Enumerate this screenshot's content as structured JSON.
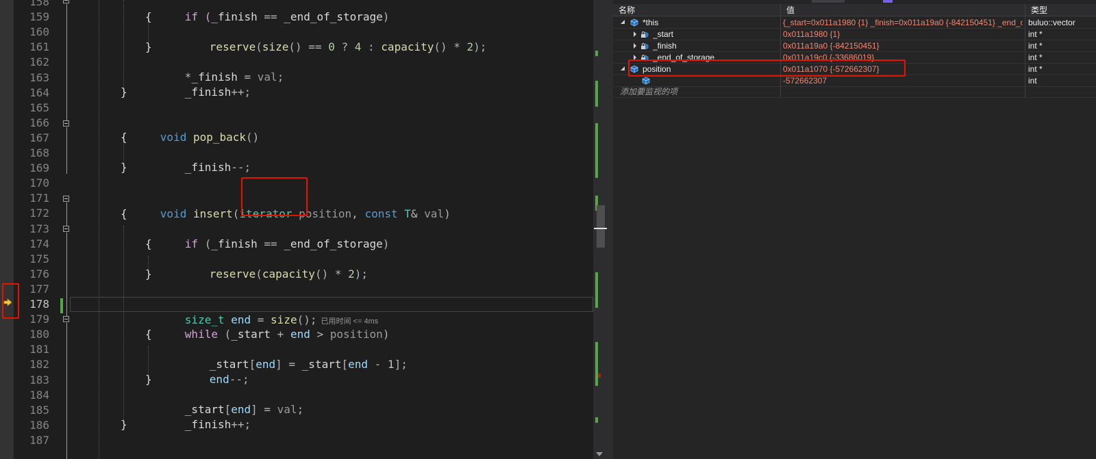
{
  "editor": {
    "line_numbers": [
      "158",
      "159",
      "160",
      "161",
      "162",
      "163",
      "164",
      "165",
      "166",
      "167",
      "168",
      "169",
      "170",
      "171",
      "172",
      "173",
      "174",
      "175",
      "176",
      "177",
      "178",
      "179",
      "180",
      "181",
      "182",
      "183",
      "184",
      "185",
      "186",
      "187"
    ],
    "current_line": "178",
    "code": {
      "l158": {
        "a": "if (",
        "b": "_finish",
        "c": " == ",
        "d": "_end_of_storage",
        "e": ")"
      },
      "l159": "{",
      "l160": {
        "fn": "reserve",
        "p1": "(",
        "fn2": "size",
        "p2": "() == ",
        "n1": "0",
        "p3": " ? ",
        "n2": "4",
        "p4": " : ",
        "fn3": "capacity",
        "p5": "() * ",
        "n3": "2",
        "p6": ");"
      },
      "l161": "}",
      "l162": {
        "a": "*",
        "b": "_finish",
        "c": " = ",
        "d": "val",
        "e": ";"
      },
      "l163": {
        "a": "_finish",
        "b": "++;"
      },
      "l164": "}",
      "l166": {
        "kw": "void",
        "fn": "pop_back",
        "p": "()"
      },
      "l167": "{",
      "l168": {
        "a": "_finish",
        "b": "--;"
      },
      "l169": "}",
      "l171": {
        "kw": "void",
        "fn": "insert",
        "p1": "(",
        "ty": "iterator",
        "pa": "position",
        "p2": ", ",
        "kw2": "const",
        "ty2": "T",
        "p3": "& ",
        "pa2": "val",
        "p4": ")"
      },
      "l172": "{",
      "l173": {
        "kw": "if",
        "p1": " (",
        "a": "_finish",
        "p2": " == ",
        "b": "_end_of_storage",
        "p3": ")"
      },
      "l174": "{",
      "l175": {
        "fn": "reserve",
        "p1": "(",
        "fn2": "capacity",
        "p2": "() * ",
        "n": "2",
        "p3": ");"
      },
      "l176": "}",
      "l178": {
        "ty": "size_t",
        "lv": "end",
        "p1": " = ",
        "fn": "size",
        "p2": "();",
        "perf": "已用时间 <= 4ms"
      },
      "l179": {
        "kw": "while",
        "p1": " (",
        "a": "_start",
        "p2": " + ",
        "lv": "end",
        "p3": " > ",
        "pa": "position",
        "p4": ")"
      },
      "l180": "{",
      "l181": {
        "a": "_start",
        "p1": "[",
        "lv": "end",
        "p2": "] = ",
        "b": "_start",
        "p3": "[",
        "lv2": "end",
        "p4": " - ",
        "n": "1",
        "p5": "];"
      },
      "l182": {
        "lv": "end",
        "p": "--;"
      },
      "l183": "}",
      "l184": {
        "a": "_start",
        "p1": "[",
        "lv": "end",
        "p2": "] = ",
        "pa": "val",
        "p3": ";"
      },
      "l185": {
        "a": "_finish",
        "p": "++;"
      },
      "l186": "}"
    }
  },
  "watch": {
    "headers": {
      "name": "名称",
      "value": "值",
      "type": "类型"
    },
    "rows": [
      {
        "name": "*this",
        "value": "{_start=0x011a1980 {1} _finish=0x011a19a0 {-842150451} _end_of_st...",
        "type": "buluo::vector"
      },
      {
        "name": "_start",
        "value": "0x011a1980 {1}",
        "type": "int *"
      },
      {
        "name": "_finish",
        "value": "0x011a19a0 {-842150451}",
        "type": "int *"
      },
      {
        "name": "_end_of_storage",
        "value": "0x011a19c0 {-33686019}",
        "type": "int *"
      },
      {
        "name": "position",
        "value": "0x011a1070 {-572662307}",
        "type": "int *"
      },
      {
        "name": "",
        "value": "-572662307",
        "type": "int"
      }
    ],
    "add_item": "添加要监视的项"
  },
  "colors": {
    "editor_bg": "#1e1e1e",
    "keyword": "#569cd6",
    "type": "#4ec9b0",
    "function": "#dcdcaa",
    "number": "#b5cea8",
    "annotation": "#e51400",
    "watch_value": "#f48771",
    "change_bar": "#57a64a"
  },
  "icons": [
    "debug-current-line-arrow-icon",
    "fold-collapse-icon",
    "object-cube-icon",
    "lock-icon",
    "expand-arrow-icon"
  ]
}
